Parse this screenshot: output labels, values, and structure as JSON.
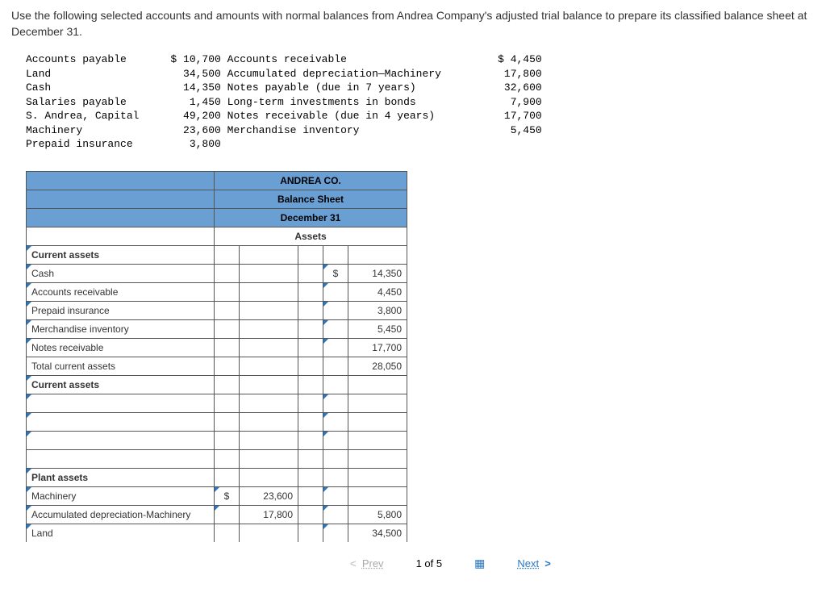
{
  "instruction": "Use the following selected accounts and amounts with normal balances from Andrea Company's adjusted trial balance to prepare its classified balance sheet at December 31.",
  "trial": {
    "left": [
      {
        "name": "Accounts payable",
        "amount": "$ 10,700"
      },
      {
        "name": "Land",
        "amount": "34,500"
      },
      {
        "name": "Cash",
        "amount": "14,350"
      },
      {
        "name": "Salaries payable",
        "amount": "1,450"
      },
      {
        "name": "S. Andrea, Capital",
        "amount": "49,200"
      },
      {
        "name": "Machinery",
        "amount": "23,600"
      },
      {
        "name": "Prepaid insurance",
        "amount": "3,800"
      }
    ],
    "right": [
      {
        "name": "Accounts receivable",
        "amount": "$ 4,450"
      },
      {
        "name": "Accumulated depreciation—Machinery",
        "amount": "17,800"
      },
      {
        "name": "Notes payable (due in 7 years)",
        "amount": "32,600"
      },
      {
        "name": "Long-term investments in bonds",
        "amount": "7,900"
      },
      {
        "name": "Notes receivable (due in 4 years)",
        "amount": "17,700"
      },
      {
        "name": "Merchandise inventory",
        "amount": "5,450"
      }
    ]
  },
  "sheet": {
    "company": "ANDREA CO.",
    "title": "Balance Sheet",
    "date": "December 31",
    "assets_header": "Assets",
    "sections": {
      "current_assets": "Current assets",
      "plant_assets": "Plant assets"
    },
    "rows": {
      "cash": {
        "label": "Cash",
        "cur": "$",
        "val": "14,350"
      },
      "ar": {
        "label": "Accounts receivable",
        "val": "4,450"
      },
      "prepaid": {
        "label": "Prepaid insurance",
        "val": "3,800"
      },
      "inv": {
        "label": "Merchandise inventory",
        "val": "5,450"
      },
      "nr": {
        "label": "Notes receivable",
        "val": "17,700"
      },
      "total_ca": {
        "label": "Total current assets",
        "val": "28,050"
      },
      "ca2": {
        "label": "Current assets"
      },
      "machinery": {
        "label": "Machinery",
        "cur": "$",
        "colb": "23,600"
      },
      "accdep": {
        "label": "Accumulated depreciation-Machinery",
        "colb": "17,800",
        "val": "5,800"
      },
      "land": {
        "label": "Land",
        "val": "34,500"
      }
    }
  },
  "pager": {
    "prev": "Prev",
    "page": "1 of 5",
    "next": "Next"
  }
}
